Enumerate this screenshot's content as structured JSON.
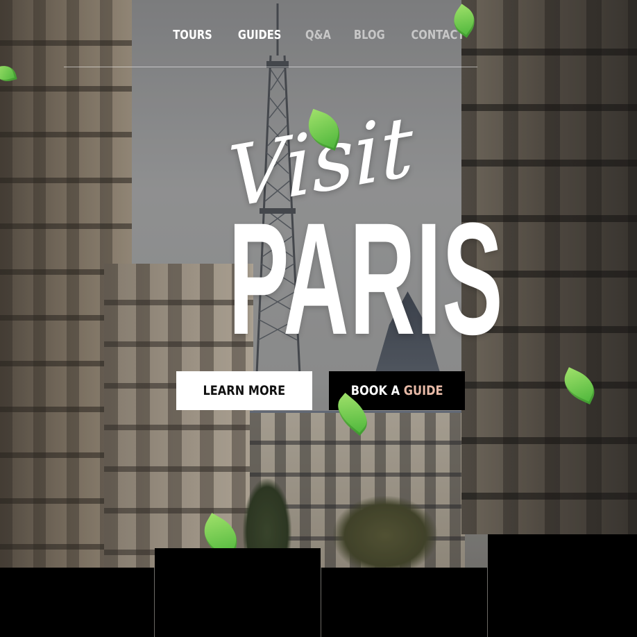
{
  "nav": {
    "items": [
      {
        "label": "TOURS"
      },
      {
        "label": "GUIDES"
      },
      {
        "label": "Q&A"
      },
      {
        "label": "BLOG"
      },
      {
        "label": "CONTACT"
      }
    ]
  },
  "hero": {
    "script_title": "Visit",
    "main_title": "PARIS",
    "background_icon": "paris-street-photo"
  },
  "buttons": {
    "learn_more": "LEARN MORE",
    "book_prefix": "BOOK A",
    "book_accent": "GUIDE"
  },
  "colors": {
    "accent": "#e6b9a6",
    "leaf": "#7ccc4f",
    "button_light": "#ffffff",
    "button_dark": "#000000"
  }
}
